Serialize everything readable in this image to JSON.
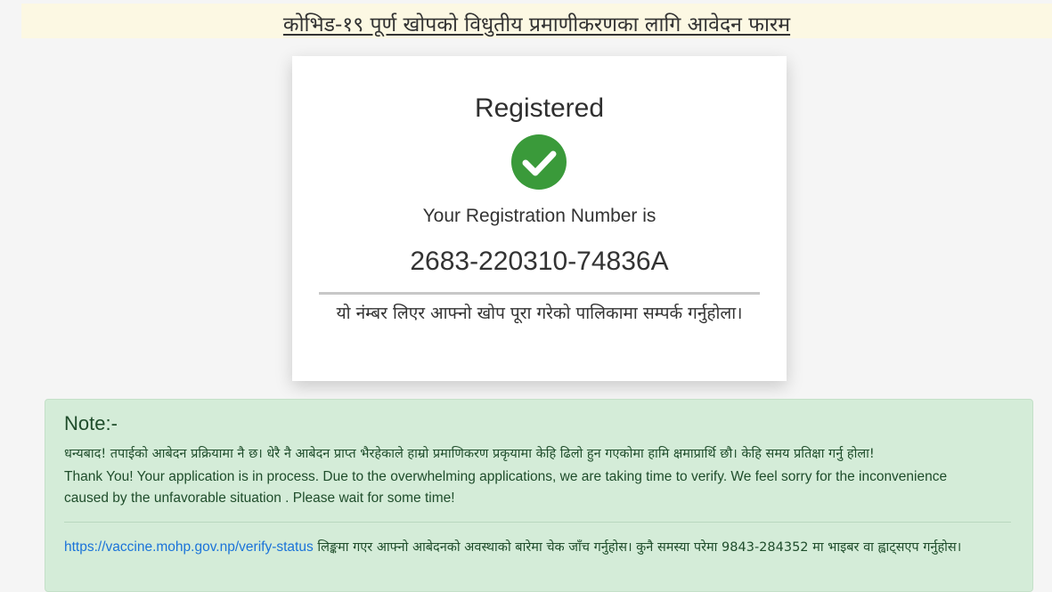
{
  "header": {
    "title": "कोभिड-१९ पूर्ण खोपको विधुतीय प्रमाणीकरणका लागि आवेदन फारम"
  },
  "card": {
    "heading": "Registered",
    "check_icon": "check-circle-icon",
    "registration_label": "Your Registration Number is",
    "registration_number": "2683-220310-74836A",
    "contact_message": "यो नंम्बर लिएर आफ्नो खोप पूरा गरेको पालिकामा सम्पर्क गर्नुहोला।",
    "success_color": "#3a9a3a"
  },
  "note": {
    "title": "Note:-",
    "message_np": "धन्यबाद! तपाईको आबेदन प्रक्रियामा नै छ। धेरै नै आबेदन प्राप्त भैरहेकाले हाम्रो प्रमाणिकरण प्रकृयामा केहि ढिलो हुन गएकोमा हामि क्षमाप्रार्थि छौ। केहि समय प्रतिक्षा गर्नु होला!",
    "message_en": "Thank You! Your application is in process. Due to the overwhelming applications, we are taking time to verify. We feel sorry for the inconvenience caused by the unfavorable situation . Please wait for some time!",
    "link_text": "https://vaccine.mohp.gov.np/verify-status",
    "link_suffix": " लिङ्कमा गएर आफ्नो आबेदनको अवस्थाको बारेमा चेक जाँच गर्नुहोस। कुनै समस्या परेमा 9843-284352 मा भाइबर वा ह्वाट्सएप गर्नुहोस।",
    "background_color": "#d4ecd8",
    "link_color": "#1a73d9"
  }
}
